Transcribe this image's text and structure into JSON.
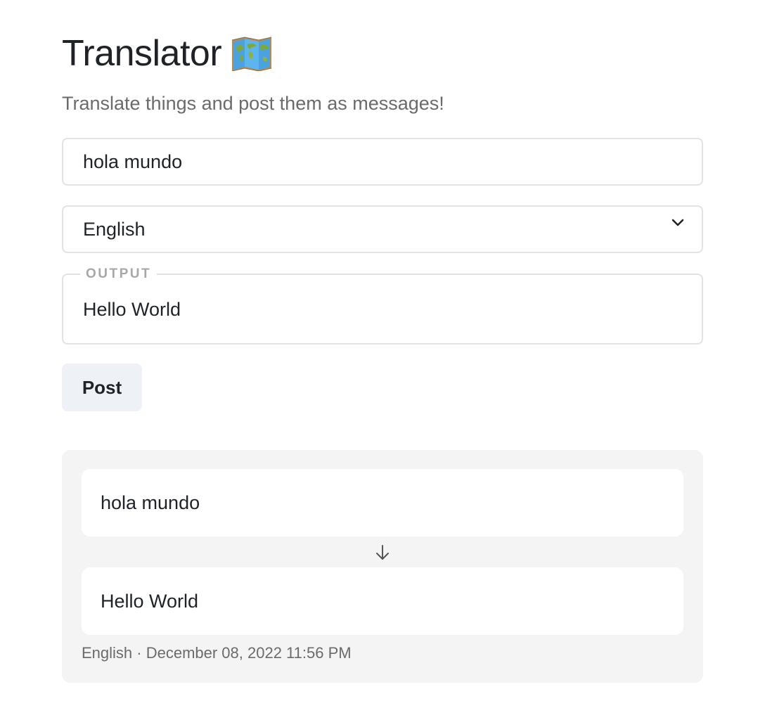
{
  "header": {
    "title": "Translator",
    "icon": "world-map-icon",
    "subtitle": "Translate things and post them as messages!"
  },
  "form": {
    "input_value": "hola mundo",
    "language_selected": "English",
    "output_label": "OUTPUT",
    "output_value": "Hello World",
    "post_label": "Post"
  },
  "messages": [
    {
      "source": "hola mundo",
      "translation": "Hello World",
      "meta": "English · December 08, 2022 11:56 PM"
    }
  ],
  "colors": {
    "button_bg": "#eef1f6",
    "card_bg": "#f4f4f4",
    "muted_text": "#6b6b6b"
  }
}
